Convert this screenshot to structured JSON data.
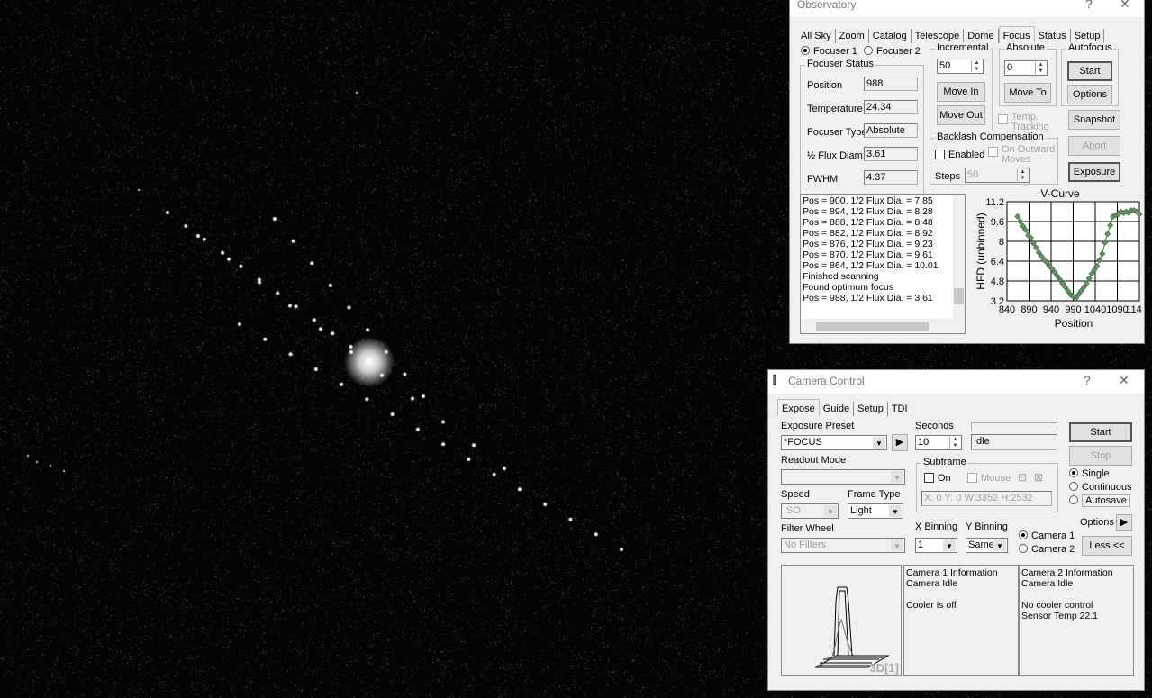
{
  "observatory": {
    "title": "Observatory",
    "help": "?",
    "close": "✕",
    "tabs": [
      "All Sky",
      "Zoom",
      "Catalog",
      "Telescope",
      "Dome",
      "Focus",
      "Status",
      "Setup"
    ],
    "active_tab": "Focus",
    "focuser1": "Focuser 1",
    "focuser2": "Focuser 2",
    "status_group": "Focuser Status",
    "position_label": "Position",
    "position": "988",
    "temperature_label": "Temperature",
    "temperature": "24.34",
    "type_label": "Focuser Type",
    "type": "Absolute",
    "flux_label": "½ Flux Diam.",
    "flux": "3.61",
    "fwhm_label": "FWHM",
    "fwhm": "4.37",
    "incremental_group": "Incremental",
    "incremental_value": "50",
    "move_in": "Move In",
    "move_out": "Move Out",
    "absolute_group": "Absolute",
    "absolute_value": "0",
    "move_to": "Move To",
    "autofocus_group": "Autofocus",
    "start": "Start",
    "options": "Options",
    "temp_tracking": "Temp. Tracking",
    "snapshot": "Snapshot",
    "abort": "Abort",
    "exposure": "Exposure",
    "backlash_group": "Backlash Compensation",
    "enabled": "Enabled",
    "on_outward": "On Outward Moves",
    "steps_label": "Steps",
    "steps_value": "50",
    "log": [
      "Pos = 900, 1/2 Flux Dia. = 7.85",
      "Pos = 894, 1/2 Flux Dia. = 8.28",
      "Pos = 888, 1/2 Flux Dia. = 8.48",
      "Pos = 882, 1/2 Flux Dia. = 8.92",
      "Pos = 876, 1/2 Flux Dia. = 9.23",
      "Pos = 870, 1/2 Flux Dia. = 9.61",
      "Pos = 864, 1/2 Flux Dia. = 10.01",
      "Finished scanning",
      "Found optimum focus",
      "Pos = 988, 1/2 Flux Dia. = 3.61"
    ]
  },
  "chart_data": {
    "type": "line",
    "title": "V-Curve",
    "xlabel": "Position",
    "ylabel": "HFD (unbinned)",
    "xlim": [
      840,
      1140
    ],
    "ylim": [
      3.2,
      11.2
    ],
    "xticks": [
      "840",
      "890",
      "940",
      "990",
      "1040",
      "1090",
      "114"
    ],
    "yticks": [
      "11.2",
      "9.6",
      "8",
      "6.4",
      "4.8",
      "3.2"
    ],
    "grid": true,
    "line_color": "#2e8b2e",
    "marker_color": "#a070a0",
    "x": [
      864,
      870,
      876,
      882,
      888,
      894,
      900,
      906,
      912,
      918,
      924,
      930,
      936,
      942,
      948,
      954,
      960,
      966,
      972,
      978,
      984,
      988,
      990,
      996,
      1002,
      1008,
      1014,
      1020,
      1026,
      1032,
      1038,
      1044,
      1050,
      1056,
      1062,
      1068,
      1074,
      1080,
      1086,
      1092,
      1098,
      1104,
      1110,
      1116,
      1122,
      1128,
      1134,
      1140
    ],
    "y": [
      10.01,
      9.61,
      9.23,
      8.92,
      8.48,
      8.28,
      7.85,
      7.5,
      7.1,
      6.8,
      6.5,
      6.3,
      6.0,
      5.8,
      5.5,
      5.2,
      4.9,
      4.6,
      4.3,
      4.0,
      3.7,
      3.61,
      3.55,
      3.4,
      3.7,
      4.0,
      4.3,
      4.6,
      5.0,
      5.4,
      5.7,
      6.0,
      6.5,
      7.0,
      7.9,
      8.6,
      9.3,
      10.0,
      10.1,
      10.2,
      10.4,
      10.3,
      10.4,
      10.3,
      10.5,
      10.5,
      10.4,
      10.2
    ]
  },
  "camera": {
    "title": "Camera Control",
    "help": "?",
    "close": "✕",
    "tabs": [
      "Expose",
      "Guide",
      "Setup",
      "TDI"
    ],
    "active_tab": "Expose",
    "preset_label": "Exposure Preset",
    "preset": "*FOCUS",
    "seconds_label": "Seconds",
    "seconds": "10",
    "status": "Idle",
    "start": "Start",
    "stop": "Stop",
    "readout_label": "Readout Mode",
    "readout": "",
    "subframe_group": "Subframe",
    "sub_on": "On",
    "sub_mouse": "Mouse",
    "subframe_coords": "X:   0 Y:   0 W:3352 H:2532",
    "single": "Single",
    "continuous": "Continuous",
    "autosave": "Autosave",
    "speed_label": "Speed",
    "speed": "ISO",
    "frame_type_label": "Frame Type",
    "frame_type": "Light",
    "options": "Options",
    "filter_label": "Filter Wheel",
    "filter": "No Filters",
    "xbin_label": "X Binning",
    "xbin": "1",
    "ybin_label": "Y Binning",
    "ybin": "Same",
    "camera1": "Camera 1",
    "camera2": "Camera 2",
    "less": "Less <<",
    "plot3d_label": "3D[1]",
    "cam1_info": [
      "Camera 1 Information",
      "Camera Idle",
      "",
      "Cooler is off"
    ],
    "cam2_info": [
      "Camera 2 Information",
      "Camera Idle",
      "",
      "No cooler control",
      "Sensor Temp 22.1"
    ]
  }
}
